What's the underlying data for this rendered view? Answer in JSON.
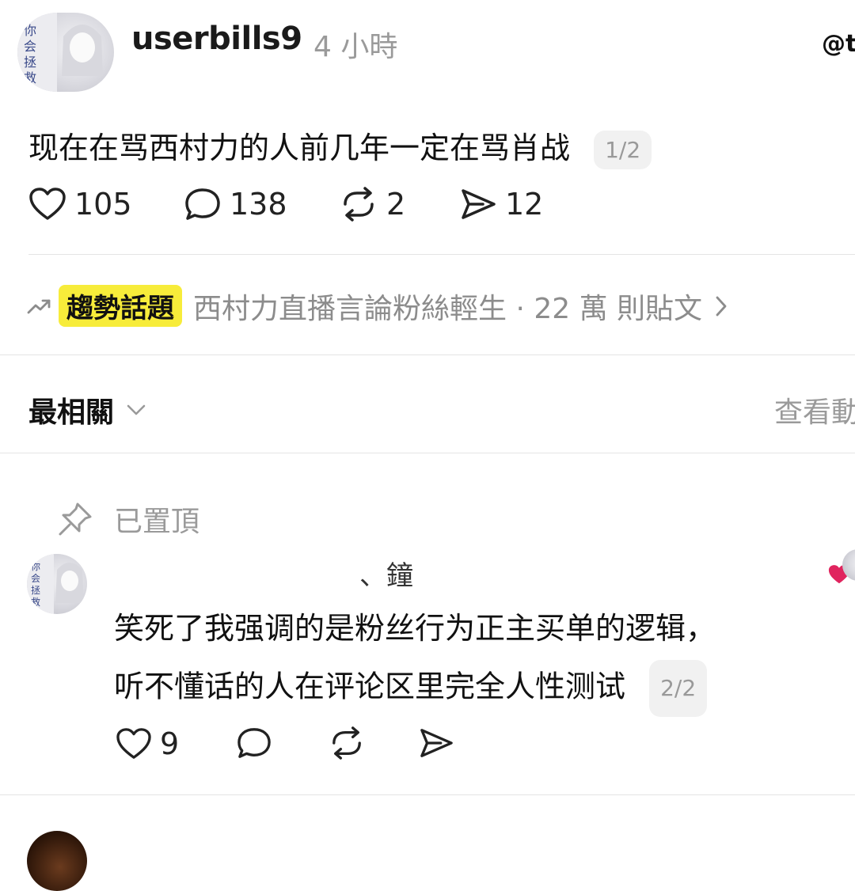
{
  "post": {
    "username": "userbills9",
    "time_ago": "4 小時",
    "text": "现在在骂西村力的人前几年一定在骂肖战",
    "pager": "1/2",
    "actions": {
      "likes": "105",
      "comments": "138",
      "reposts": "2",
      "shares": "12"
    }
  },
  "trending": {
    "tag": "趨勢話題",
    "text": "西村力直播言論粉絲輕生 · 22 萬 則貼文"
  },
  "sort": {
    "label": "最相關",
    "view_more": "查看動"
  },
  "pinned": {
    "label": "已置頂"
  },
  "comment": {
    "username": "、鐘",
    "text_line1": "笑死了我强调的是粉丝行为正主买单的逻辑，",
    "text_line2": "听不懂话的人在评论区里完全人性测试",
    "pager": "2/2",
    "actions": {
      "likes": "9"
    }
  },
  "colors": {
    "trend_highlight": "#f7ec3a",
    "like_heart": "#e0245e"
  }
}
